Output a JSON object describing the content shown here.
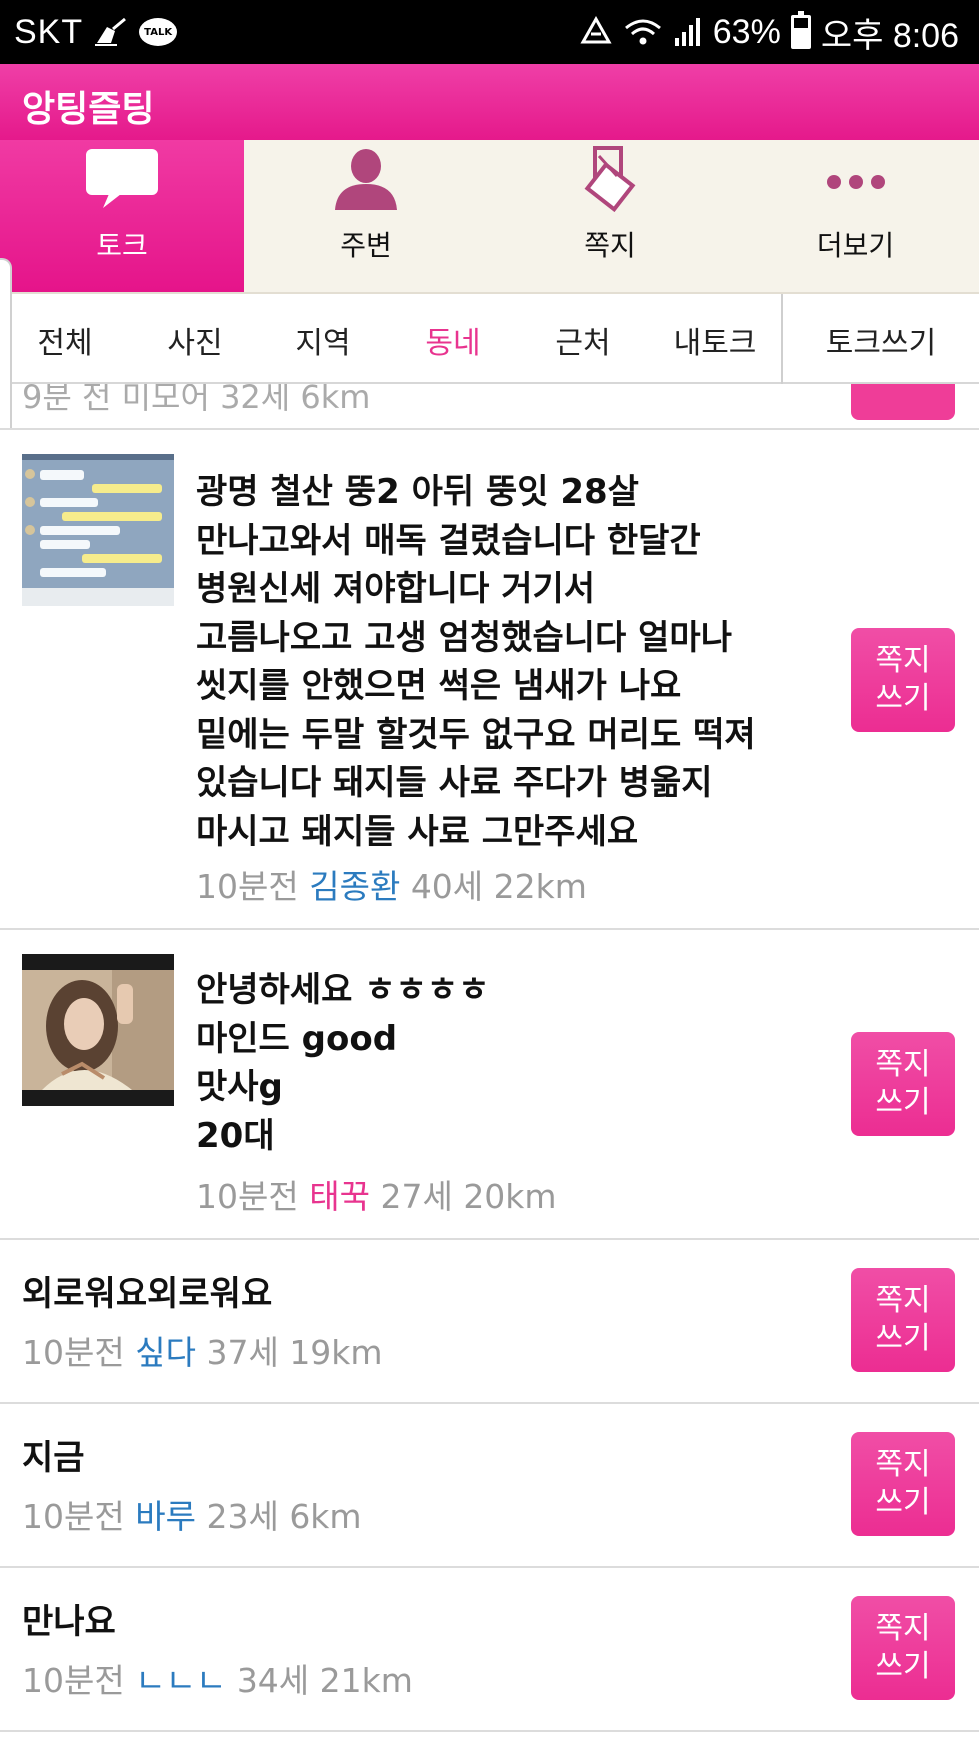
{
  "status_bar": {
    "carrier": "SKT",
    "talk_badge": "TALK",
    "battery": "63%",
    "time": "오후 8:06"
  },
  "app_bar": {
    "title": "앙팅즐팅"
  },
  "main_tabs": [
    {
      "label": "토크",
      "icon": "speech-bubble-icon",
      "active": true
    },
    {
      "label": "주변",
      "icon": "person-icon",
      "active": false
    },
    {
      "label": "쪽지",
      "icon": "note-icon",
      "active": false
    },
    {
      "label": "더보기",
      "icon": "more-dots-icon",
      "active": false
    }
  ],
  "sub_tabs": {
    "items": [
      "전체",
      "사진",
      "지역",
      "동네",
      "근처",
      "내토크"
    ],
    "active": "동네",
    "write": "토크쓰기"
  },
  "partial_row": {
    "meta": "9분 전 미모어 32세 6km"
  },
  "posts": [
    {
      "lines": [
        "광명 철산 뚱2 아뒤 뚱잇 28살",
        "만나고와서 매독 걸렸습니다 한달간",
        "병원신세 져야합니다 거기서",
        "고름나오고 고생 엄청했습니다 얼마나",
        "씻지를 안했으면 썩은 냄새가 나요",
        "밑에는 두말 할것두 없구요 머리도 떡져",
        "있습니다 돼지들 사료 주다가 병옮지",
        "마시고 돼지들 사료 그만주세요"
      ],
      "time": "10분전",
      "nick": "김종환",
      "age": "40세",
      "dist": "22km",
      "nick_color": "#2b7bbf",
      "button": [
        "쪽지",
        "쓰기"
      ]
    },
    {
      "lines": [
        "안녕하세요  ㅎㅎㅎㅎ",
        "마인드    good",
        "맛사g",
        "20대"
      ],
      "time": "10분전",
      "nick": "태꾹",
      "age": "27세",
      "dist": "20km",
      "nick_color": "#e8348f",
      "button": [
        "쪽지",
        "쓰기"
      ]
    },
    {
      "lines": [
        "외로워요외로워요"
      ],
      "time": "10분전",
      "nick": "싶다",
      "age": "37세",
      "dist": "19km",
      "nick_color": "#2b7bbf",
      "button": [
        "쪽지",
        "쓰기"
      ]
    },
    {
      "lines": [
        "지금"
      ],
      "time": "10분전",
      "nick": "바루",
      "age": "23세",
      "dist": "6km",
      "nick_color": "#2b7bbf",
      "button": [
        "쪽지",
        "쓰기"
      ]
    },
    {
      "lines": [
        "만나요"
      ],
      "time": "10분전",
      "nick": "ㄴㄴㄴ",
      "age": "34세",
      "dist": "21km",
      "nick_color": "#2b7bbf",
      "button": [
        "쪽지",
        "쓰기"
      ]
    }
  ],
  "colors": {
    "brand_pink": "#e5198b",
    "tab_bg": "#f6f3ea",
    "nick_blue": "#2b7bbf",
    "nick_pink": "#e8348f",
    "meta_gray": "#9a9a9a"
  }
}
